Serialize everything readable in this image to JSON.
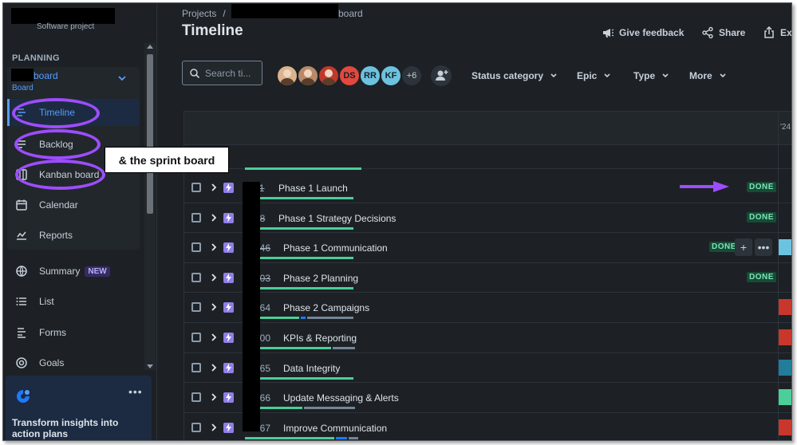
{
  "project": {
    "subtitle": "Software project"
  },
  "sidebar": {
    "section": "PLANNING",
    "board": {
      "name": "board",
      "type": "Board"
    },
    "items": [
      {
        "label": "Timeline",
        "icon": "timeline-icon",
        "active": true
      },
      {
        "label": "Backlog",
        "icon": "backlog-icon"
      },
      {
        "label": "Kanban board",
        "icon": "board-icon"
      },
      {
        "label": "Calendar",
        "icon": "calendar-icon"
      },
      {
        "label": "Reports",
        "icon": "reports-icon"
      }
    ],
    "outer": [
      {
        "label": "Summary",
        "icon": "globe-icon",
        "badge": "NEW"
      },
      {
        "label": "List",
        "icon": "list-icon"
      },
      {
        "label": "Forms",
        "icon": "forms-icon"
      },
      {
        "label": "Goals",
        "icon": "goals-icon"
      }
    ],
    "promo": {
      "text": "Transform insights into action plans",
      "more": "•••"
    }
  },
  "annotation": {
    "callout": "& the sprint board"
  },
  "header": {
    "crumb_root": "Projects",
    "crumb_sep": "/",
    "crumb_board": "board",
    "title": "Timeline",
    "feedback": "Give feedback",
    "share": "Share",
    "export": "Exp"
  },
  "toolbar": {
    "search_placeholder": "Search ti...",
    "avatars": [
      {
        "type": "photo",
        "color": "#d9b48f"
      },
      {
        "type": "photo",
        "color": "#b88a6a"
      },
      {
        "type": "photo",
        "color": "#c0392b"
      },
      {
        "type": "initials",
        "text": "DS",
        "color": "#e2483d"
      },
      {
        "type": "initials",
        "text": "RR",
        "color": "#6cc3e0"
      },
      {
        "type": "initials",
        "text": "KF",
        "color": "#6cc3e0"
      }
    ],
    "more_count": "+6",
    "filters": [
      "Status category",
      "Epic",
      "Type",
      "More"
    ]
  },
  "timeline": {
    "year_label": "'24",
    "rows": [
      {
        "key": "-11",
        "struck": true,
        "summary": "Phase 1 Launch",
        "status": "DONE",
        "bar": [
          {
            "w": 136,
            "c": "#4bce97"
          }
        ]
      },
      {
        "key": "-18",
        "struck": true,
        "summary": "Phase 1 Strategy Decisions",
        "status": "DONE",
        "bar": [
          {
            "w": 136,
            "c": "#4bce97"
          }
        ]
      },
      {
        "key": "-246",
        "struck": true,
        "summary": "Phase 1 Communication",
        "status": "DONE",
        "hover": true,
        "tl": "#6cc3e0",
        "bar": [
          {
            "w": 136,
            "c": "#4bce97"
          }
        ]
      },
      {
        "key": "-203",
        "struck": true,
        "summary": "Phase 2 Planning",
        "status": "DONE",
        "bar": [
          {
            "w": 136,
            "c": "#4bce97"
          }
        ]
      },
      {
        "key": "-264",
        "struck": false,
        "summary": "Phase 2 Campaigns",
        "tl": "#c9372c",
        "bar": [
          {
            "w": 68,
            "c": "#4bce97"
          },
          {
            "w": 6,
            "c": "#1d7afc"
          },
          {
            "w": 58,
            "c": "#738496"
          }
        ]
      },
      {
        "key": "-200",
        "struck": false,
        "summary": "KPIs & Reporting",
        "tl": "#c9372c",
        "bar": [
          {
            "w": 108,
            "c": "#4bce97"
          },
          {
            "w": 28,
            "c": "#738496"
          }
        ]
      },
      {
        "key": "-265",
        "struck": false,
        "summary": "Data Integrity",
        "tl": "#227d9b",
        "bar": [
          {
            "w": 136,
            "c": "#4bce97"
          }
        ]
      },
      {
        "key": "-266",
        "struck": false,
        "summary": "Update Messaging & Alerts",
        "tl": "#4bce97",
        "bar": [
          {
            "w": 72,
            "c": "#4bce97"
          },
          {
            "w": 64,
            "c": "#738496"
          }
        ]
      },
      {
        "key": "-267",
        "struck": false,
        "summary": "Improve Communication",
        "tl": "#c9372c",
        "bar": [
          {
            "w": 112,
            "c": "#4bce97"
          },
          {
            "w": 14,
            "c": "#1d7afc"
          },
          {
            "w": 12,
            "c": "#738496"
          }
        ]
      }
    ]
  }
}
